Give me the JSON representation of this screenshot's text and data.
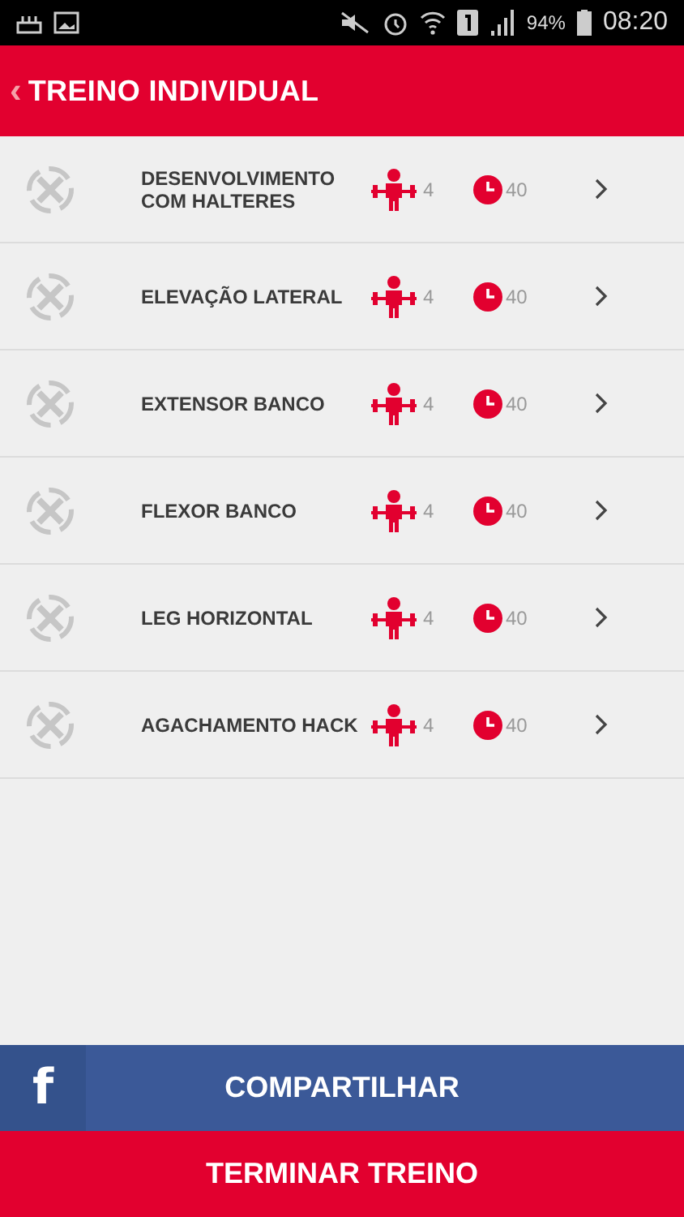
{
  "status_bar": {
    "battery": "94%",
    "time": "08:20"
  },
  "header": {
    "back": "‹",
    "title": "TREINO INDIVIDUAL"
  },
  "exercises": [
    {
      "name": "DESENVOLVIMENTO COM HALTERES",
      "sets": "4",
      "rest": "40",
      "done": false
    },
    {
      "name": "ELEVAÇÃO LATERAL",
      "sets": "4",
      "rest": "40",
      "done": false
    },
    {
      "name": "EXTENSOR BANCO",
      "sets": "4",
      "rest": "40",
      "done": false
    },
    {
      "name": "FLEXOR BANCO",
      "sets": "4",
      "rest": "40",
      "done": false
    },
    {
      "name": "LEG HORIZONTAL",
      "sets": "4",
      "rest": "40",
      "done": false
    },
    {
      "name": "AGACHAMENTO HACK",
      "sets": "4",
      "rest": "40",
      "done": false
    }
  ],
  "share_button": {
    "icon": "f",
    "label": "COMPARTILHAR"
  },
  "finish_button": {
    "label": "TERMINAR TREINO"
  }
}
